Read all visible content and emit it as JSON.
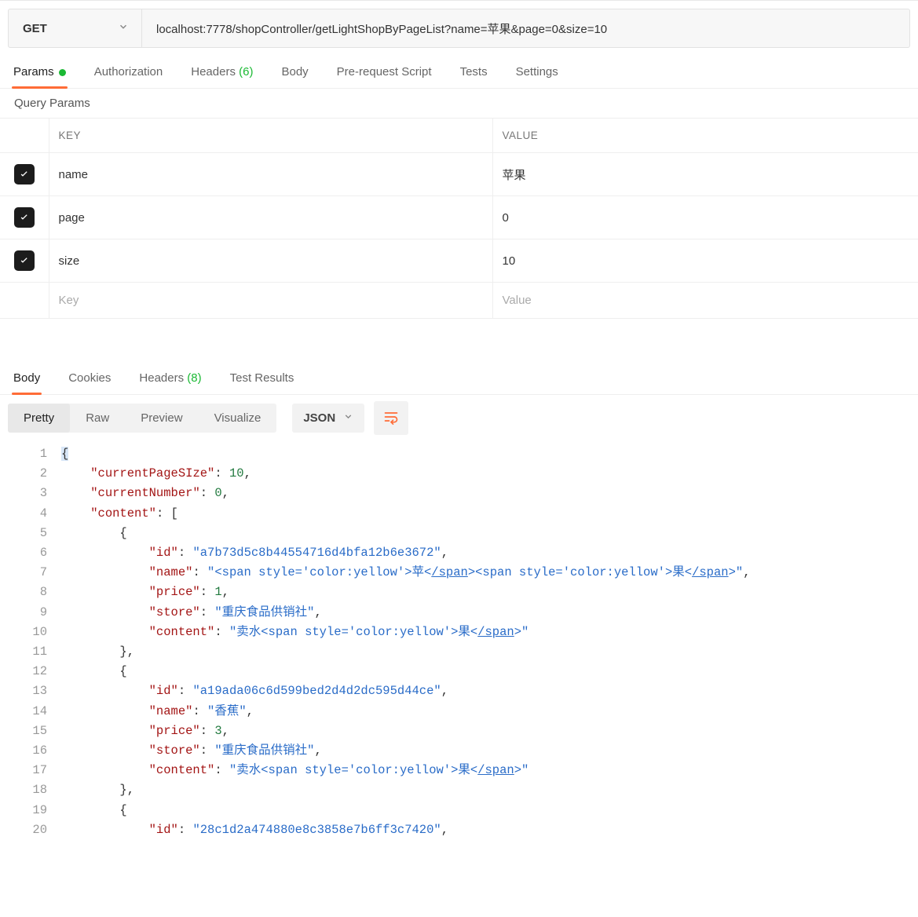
{
  "request": {
    "method": "GET",
    "url": "localhost:7778/shopController/getLightShopByPageList?name=苹果&page=0&size=10"
  },
  "reqTabs": {
    "params": "Params",
    "authorization": "Authorization",
    "headers": "Headers",
    "headers_count": "(6)",
    "body": "Body",
    "prerequest": "Pre-request Script",
    "tests": "Tests",
    "settings": "Settings"
  },
  "section": {
    "query_params": "Query Params"
  },
  "paramsTable": {
    "header_key": "KEY",
    "header_value": "VALUE",
    "rows": [
      {
        "key": "name",
        "value": "苹果"
      },
      {
        "key": "page",
        "value": "0"
      },
      {
        "key": "size",
        "value": "10"
      }
    ],
    "placeholder_key": "Key",
    "placeholder_value": "Value"
  },
  "respTabs": {
    "body": "Body",
    "cookies": "Cookies",
    "headers": "Headers",
    "headers_count": "(8)",
    "test_results": "Test Results"
  },
  "formatTabs": {
    "pretty": "Pretty",
    "raw": "Raw",
    "preview": "Preview",
    "visualize": "Visualize"
  },
  "bodyTypeSelector": "JSON",
  "code": {
    "lines": [
      "1",
      "2",
      "3",
      "4",
      "5",
      "6",
      "7",
      "8",
      "9",
      "10",
      "11",
      "12",
      "13",
      "14",
      "15",
      "16",
      "17",
      "18",
      "19",
      "20"
    ],
    "k_currentPageSize": "\"currentPageSIze\"",
    "v_currentPageSize": "10",
    "k_currentNumber": "\"currentNumber\"",
    "v_currentNumber": "0",
    "k_content": "\"content\"",
    "k_id": "\"id\"",
    "k_name": "\"name\"",
    "k_price": "\"price\"",
    "k_store": "\"store\"",
    "k_itemcontent": "\"content\"",
    "obj1_id": "\"a7b73d5c8b44554716d4bfa12b6e3672\"",
    "obj1_name_seg1": "\"<span style='color:yellow'>苹<",
    "obj1_name_link1": "/span",
    "obj1_name_seg2": "><span style='color:yellow'>果<",
    "obj1_name_link2": "/span",
    "obj1_name_seg3": ">\"",
    "obj1_price": "1",
    "obj1_store": "\"重庆食品供销社\"",
    "obj1_content_seg1": "\"卖水<span style='color:yellow'>果<",
    "obj1_content_link": "/span",
    "obj1_content_seg2": ">\"",
    "obj2_id": "\"a19ada06c6d599bed2d4d2dc595d44ce\"",
    "obj2_name": "\"香蕉\"",
    "obj2_price": "3",
    "obj2_store": "\"重庆食品供销社\"",
    "obj2_content_seg1": "\"卖水<span style='color:yellow'>果<",
    "obj2_content_link": "/span",
    "obj2_content_seg2": ">\"",
    "obj3_id": "\"28c1d2a474880e8c3858e7b6ff3c7420\""
  }
}
